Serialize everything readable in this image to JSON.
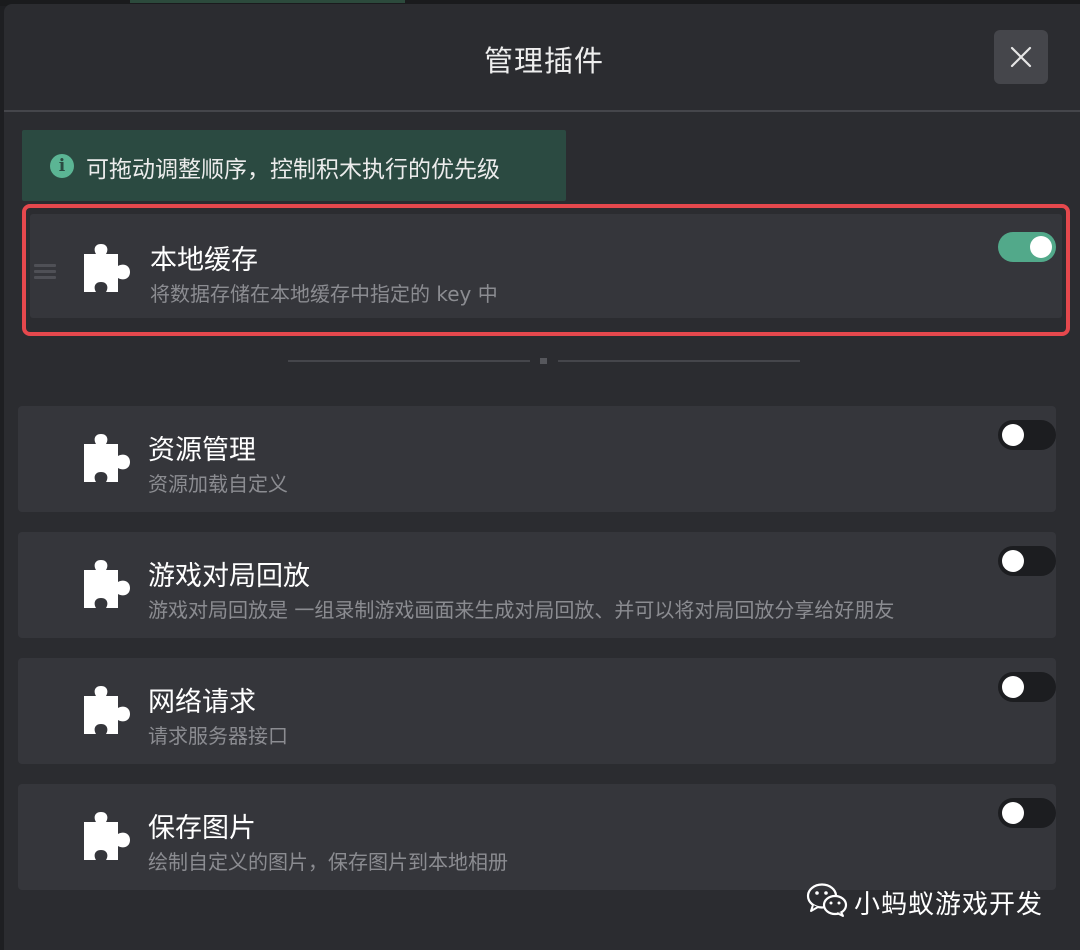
{
  "dialog": {
    "title": "管理插件",
    "close_icon": "close-icon"
  },
  "tip": {
    "icon": "info-icon",
    "icon_glyph": "i",
    "text": "可拖动调整顺序，控制积木执行的优先级"
  },
  "plugins": [
    {
      "name": "本地缓存",
      "description": "将数据存储在本地缓存中指定的 key 中",
      "enabled": true,
      "highlighted": true,
      "icon": "puzzle-icon"
    },
    {
      "name": "资源管理",
      "description": "资源加载自定义",
      "enabled": false,
      "icon": "puzzle-icon"
    },
    {
      "name": "游戏对局回放",
      "description": "游戏对局回放是 一组录制游戏画面来生成对局回放、并可以将对局回放分享给好朋友",
      "enabled": false,
      "icon": "puzzle-icon"
    },
    {
      "name": "网络请求",
      "description": "请求服务器接口",
      "enabled": false,
      "icon": "puzzle-icon"
    },
    {
      "name": "保存图片",
      "description": "绘制自定义的图片，保存图片到本地相册",
      "enabled": false,
      "icon": "puzzle-icon"
    }
  ],
  "watermark": {
    "icon": "wechat-icon",
    "text": "小蚂蚁游戏开发"
  },
  "colors": {
    "accent_green": "#52a98a",
    "highlight_red": "#e5484d",
    "tip_background": "#2b4a41"
  }
}
